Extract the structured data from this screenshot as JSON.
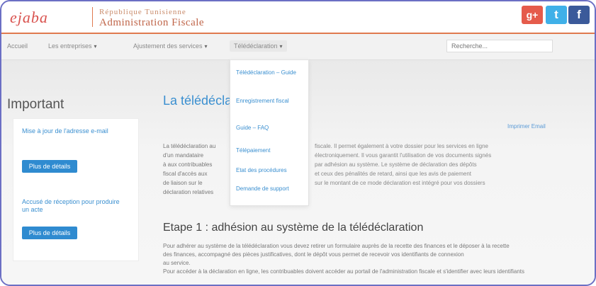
{
  "header": {
    "logo_text": "ejaba",
    "brand_sub": "République Tunisienne",
    "brand_main": "Administration Fiscale",
    "social": {
      "gplus": "g+",
      "twitter": "t",
      "facebook": "f"
    }
  },
  "nav": {
    "items": [
      {
        "label": "Accueil"
      },
      {
        "label": "Les entreprises"
      },
      {
        "label": "Ajustement des services"
      },
      {
        "label": "Télédéclaration"
      }
    ],
    "search_placeholder": "Recherche..."
  },
  "dropdown": {
    "items": [
      "Télédéclaration – Guide",
      "Enregistrement fiscal",
      "Guide – FAQ",
      "Télépaiement",
      "Etat des procédures",
      "Demande de support"
    ]
  },
  "sidebar": {
    "title": "Important",
    "link1": "Mise à jour de l'adresse e-mail",
    "button1": "Plus de détails",
    "link2": "Accusé de réception pour produire un acte",
    "button2": "Plus de détails"
  },
  "main": {
    "title": "La télédéclaration",
    "share": "Imprimer  Email",
    "para_lines": [
      "La télédéclaration au",
      "d'un mandataire",
      "à aux contribuables",
      "fiscal d'accès aux",
      "de liaison sur le",
      "déclaration relatives"
    ],
    "para_right_lines": [
      "fiscale. Il permet également à votre dossier pour les services en ligne",
      "électroniquement. Il vous garantit l'utilisation de vos documents signés",
      "par adhésion au système. Le système de déclaration des dépôts",
      "et ceux des pénalités de retard, ainsi que les avis de paiement",
      "sur le montant de ce mode déclaration est intégré pour vos dossiers"
    ],
    "section_title": "Etape 1 : adhésion au système de la télédéclaration",
    "body_lines": [
      "Pour adhérer au système de la télédéclaration vous devez retirer un formulaire auprès de la recette des finances et le déposer à la recette",
      "des finances, accompagné des pièces justificatives, dont le dépôt vous permet de recevoir vos identifiants de connexion",
      "au service.",
      "Pour accéder à la déclaration en ligne, les contribuables doivent accéder au portail de l'administration fiscale et s'identifier avec leurs identifiants"
    ]
  },
  "colors": {
    "accent": "#3a8fd0",
    "brand": "#c0664a",
    "frame": "#6b6fc4"
  }
}
